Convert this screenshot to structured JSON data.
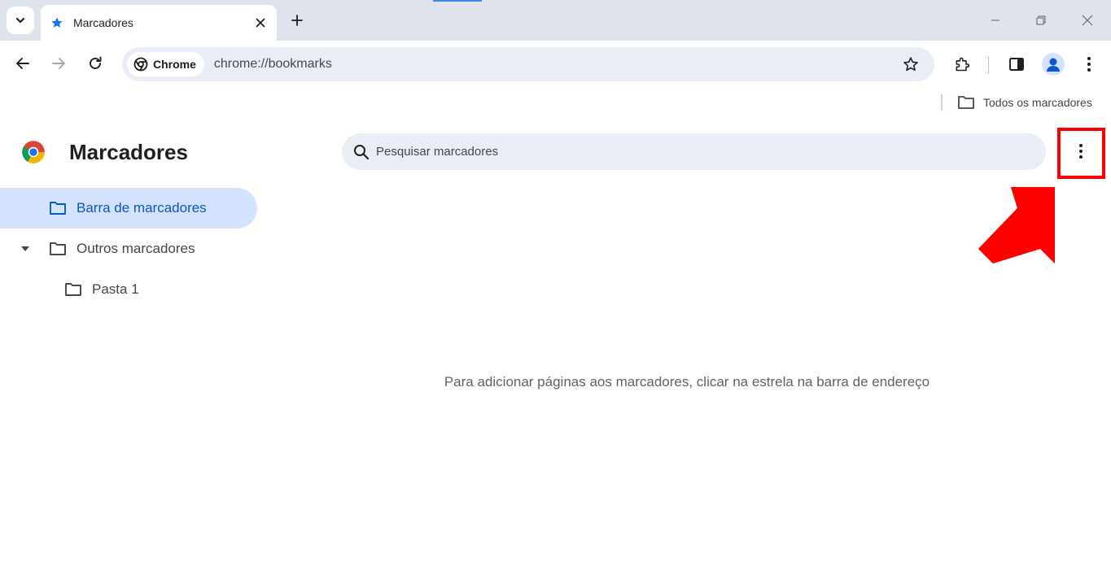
{
  "tab": {
    "title": "Marcadores"
  },
  "omnibox": {
    "chip_label": "Chrome",
    "url": "chrome://bookmarks"
  },
  "bookmarks_bar": {
    "all_bookmarks_label": "Todos os marcadores"
  },
  "page": {
    "title": "Marcadores",
    "search_placeholder": "Pesquisar marcadores",
    "empty_message": "Para adicionar páginas aos marcadores, clicar na estrela na barra de endereço"
  },
  "sidebar": {
    "items": [
      {
        "label": "Barra de marcadores",
        "selected": true,
        "icon": "folder-icon"
      },
      {
        "label": "Outros marcadores",
        "expanded": true,
        "icon": "folder-icon"
      },
      {
        "label": "Pasta 1",
        "icon": "folder-icon"
      }
    ]
  },
  "colors": {
    "accent": "#0b57d0",
    "selected_bg": "#d3e3fd",
    "annotation": "#ff0000"
  }
}
